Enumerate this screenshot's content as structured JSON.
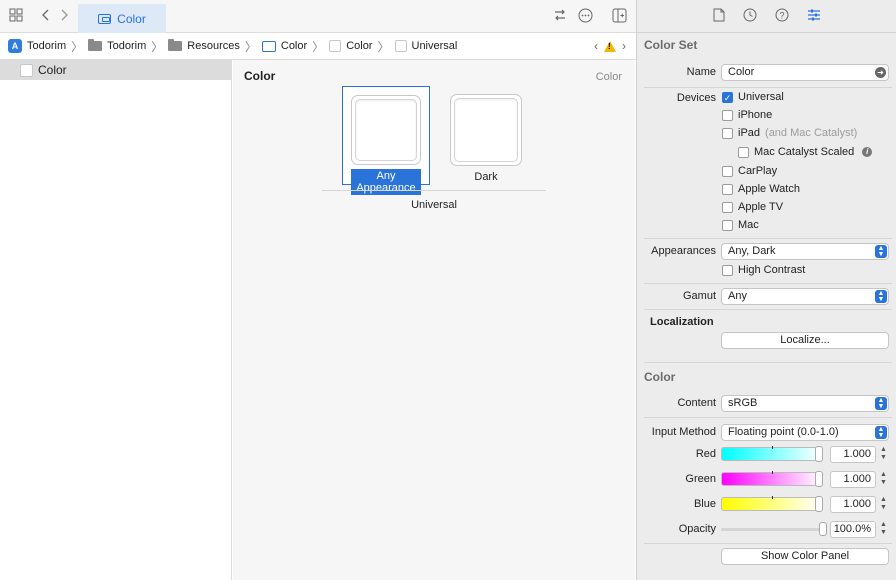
{
  "tabbar": {
    "active_tab": "Color",
    "icons": [
      "grid-icon",
      "back-icon",
      "forward-icon",
      "swap-icon",
      "more-icon",
      "add-editor-icon"
    ]
  },
  "breadcrumb": {
    "items": [
      {
        "label": "Todorim",
        "icon": "app-icon"
      },
      {
        "label": "Todorim",
        "icon": "folder-icon"
      },
      {
        "label": "Resources",
        "icon": "folder-icon"
      },
      {
        "label": "Color",
        "icon": "colorset-icon"
      },
      {
        "label": "Color",
        "icon": "swatch-icon"
      },
      {
        "label": "Universal",
        "icon": "swatch-icon"
      }
    ]
  },
  "outline": {
    "items": [
      {
        "label": "Color"
      }
    ]
  },
  "editor": {
    "title": "Color",
    "right_label": "Color",
    "wells": [
      {
        "label": "Any Appearance",
        "selected": true
      },
      {
        "label": "Dark",
        "selected": false
      }
    ],
    "group_label": "Universal"
  },
  "inspector": {
    "color_set": {
      "title": "Color Set",
      "name_label": "Name",
      "name_value": "Color",
      "devices_label": "Devices",
      "devices": [
        {
          "label": "Universal",
          "checked": true,
          "note": ""
        },
        {
          "label": "iPhone",
          "checked": false,
          "note": ""
        },
        {
          "label": "iPad",
          "checked": false,
          "note": "(and Mac Catalyst)"
        },
        {
          "label": "Mac Catalyst Scaled",
          "checked": false,
          "note": ""
        },
        {
          "label": "CarPlay",
          "checked": false,
          "note": ""
        },
        {
          "label": "Apple Watch",
          "checked": false,
          "note": ""
        },
        {
          "label": "Apple TV",
          "checked": false,
          "note": ""
        },
        {
          "label": "Mac",
          "checked": false,
          "note": ""
        }
      ],
      "appearances_label": "Appearances",
      "appearances_value": "Any, Dark",
      "high_contrast_label": "High Contrast",
      "gamut_label": "Gamut",
      "gamut_value": "Any",
      "localization_label": "Localization",
      "localize_button": "Localize..."
    },
    "color": {
      "title": "Color",
      "content_label": "Content",
      "content_value": "sRGB",
      "input_method_label": "Input Method",
      "input_method_value": "Floating point (0.0-1.0)",
      "red_label": "Red",
      "red_value": "1.000",
      "green_label": "Green",
      "green_value": "1.000",
      "blue_label": "Blue",
      "blue_value": "1.000",
      "opacity_label": "Opacity",
      "opacity_value": "100.0%",
      "show_panel_button": "Show Color Panel"
    }
  },
  "colors": {
    "accent": "#2a73d8",
    "warning": "#f2b700"
  }
}
